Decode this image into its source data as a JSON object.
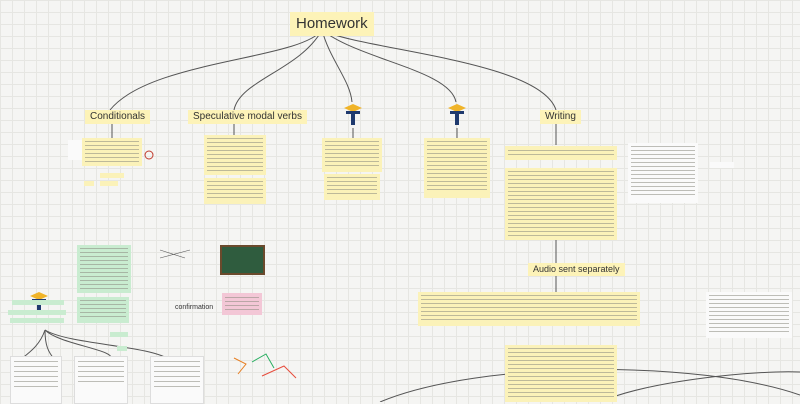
{
  "board": {
    "root_title": "Homework",
    "topics": {
      "conditionals": "Conditionals",
      "speculative": "Speculative modal verbs",
      "writing": "Writing",
      "audio": "Audio sent separately",
      "confirmation": "confirmation"
    }
  },
  "icons": {
    "logo": "academic-cap-t-logo",
    "chalkboard": "chalkboard-image"
  },
  "colors": {
    "sticky_yellow": "#fbf2b9",
    "topic_yellow": "#fdf3b8",
    "sticky_green": "#c9ecd0",
    "sticky_pink": "#f3c7d6",
    "connector": "#555555",
    "logo_blue": "#1f3a6e",
    "logo_gold": "#f0b429"
  }
}
